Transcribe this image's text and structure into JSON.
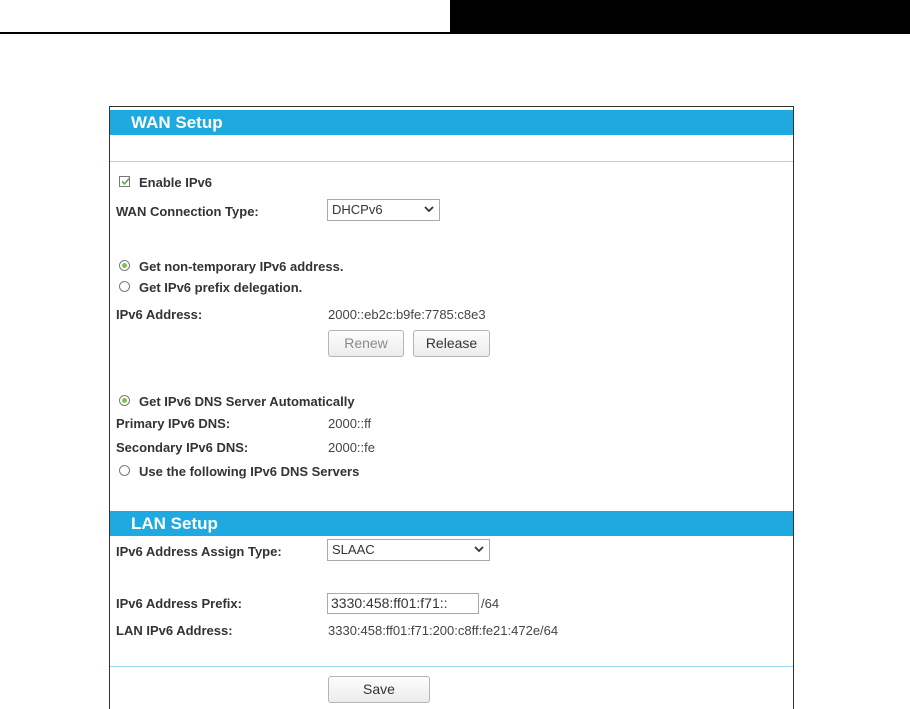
{
  "wan": {
    "title": "WAN Setup",
    "enable_ipv6_label": "Enable IPv6",
    "enable_ipv6_checked": true,
    "connection_type_label": "WAN Connection Type:",
    "connection_type_value": "DHCPv6",
    "opt_non_temp_label": "Get non-temporary IPv6 address.",
    "opt_prefix_label": "Get IPv6 prefix delegation.",
    "ipv6_address_label": "IPv6 Address:",
    "ipv6_address_value": "2000::eb2c:b9fe:7785:c8e3",
    "renew_label": "Renew",
    "release_label": "Release",
    "dns_auto_label": "Get IPv6 DNS Server Automatically",
    "primary_dns_label": "Primary IPv6 DNS:",
    "primary_dns_value": "2000::ff",
    "secondary_dns_label": "Secondary IPv6 DNS:",
    "secondary_dns_value": "2000::fe",
    "dns_manual_label": "Use the following IPv6 DNS Servers"
  },
  "lan": {
    "title": "LAN Setup",
    "assign_type_label": "IPv6 Address Assign Type:",
    "assign_type_value": "SLAAC",
    "prefix_label": "IPv6 Address Prefix:",
    "prefix_value": "3330:458:ff01:f71::",
    "prefix_suffix": "/64",
    "lan_address_label": "LAN IPv6 Address:",
    "lan_address_value": "3330:458:ff01:f71:200:c8ff:fe21:472e/64"
  },
  "save_label": "Save",
  "colors": {
    "header": "#1fa9e1",
    "divider": "#9fd6ef",
    "radio_on": "#7fbf4f"
  }
}
